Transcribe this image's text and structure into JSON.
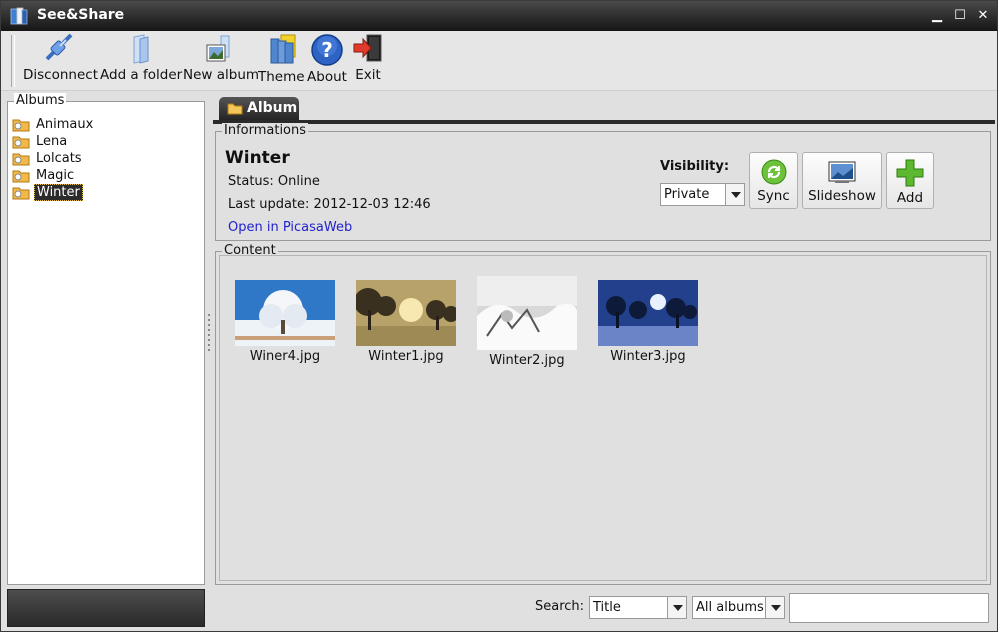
{
  "window": {
    "title": "See&Share"
  },
  "toolbar": {
    "items": [
      {
        "label": "Disconnect",
        "icon": "disconnect-icon"
      },
      {
        "label": "Add a folder",
        "icon": "folder-icon"
      },
      {
        "label": "New album",
        "icon": "new-album-icon"
      },
      {
        "label": "Theme",
        "icon": "theme-icon"
      },
      {
        "label": "About",
        "icon": "help-icon"
      },
      {
        "label": "Exit",
        "icon": "exit-icon"
      }
    ]
  },
  "albums": {
    "legend": "Albums",
    "items": [
      {
        "label": "Animaux",
        "selected": false
      },
      {
        "label": "Lena",
        "selected": false
      },
      {
        "label": "Lolcats",
        "selected": false
      },
      {
        "label": "Magic",
        "selected": false
      },
      {
        "label": "Winter",
        "selected": true
      }
    ]
  },
  "tab": {
    "label": "Album"
  },
  "info": {
    "legend": "Informations",
    "title": "Winter",
    "status": "Status: Online",
    "last_update": "Last update: 2012-12-03 12:46",
    "link": "Open in PicasaWeb",
    "visibility_label": "Visibility:",
    "visibility_value": "Private"
  },
  "buttons": {
    "sync": "Sync",
    "slideshow": "Slideshow",
    "add": "Add"
  },
  "content": {
    "legend": "Content",
    "photos": [
      {
        "name": "Winer4.jpg"
      },
      {
        "name": "Winter1.jpg"
      },
      {
        "name": "Winter2.jpg"
      },
      {
        "name": "Winter3.jpg"
      }
    ]
  },
  "search": {
    "label": "Search:",
    "field": "Title",
    "scope": "All albums",
    "value": ""
  },
  "colors": {
    "titlebar": "#1e1e1e",
    "selection": "#2b2b2b",
    "link": "#2222cc",
    "accent_green": "#5cb82e"
  }
}
